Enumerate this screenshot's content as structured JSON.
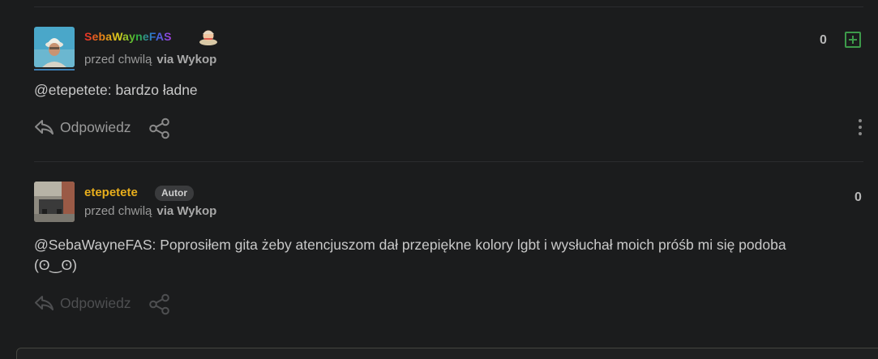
{
  "comments": [
    {
      "username": "SebaWayneFAS",
      "time": "przed chwilą",
      "via": "via Wykop",
      "votes": "0",
      "mention": "@etepetete",
      "text": ": bardzo ładne",
      "reply_label": "Odpowiedz"
    },
    {
      "username": "etepetete",
      "author_badge": "Autor",
      "time": "przed chwilą",
      "via": "via Wykop",
      "votes": "0",
      "mention": "@SebaWayneFAS",
      "text": ": Poprosiłem gita żeby atencjuszom dał przepiękne kolory lgbt i wysłuchał moich próśb mi się podoba",
      "text_line2": "(ʘ‿ʘ)",
      "reply_label": "Odpowiedz"
    }
  ],
  "colors": {
    "background": "#1b1c1d",
    "upvote_green": "#3d9a4a",
    "author_name": "#e8ae1c"
  }
}
